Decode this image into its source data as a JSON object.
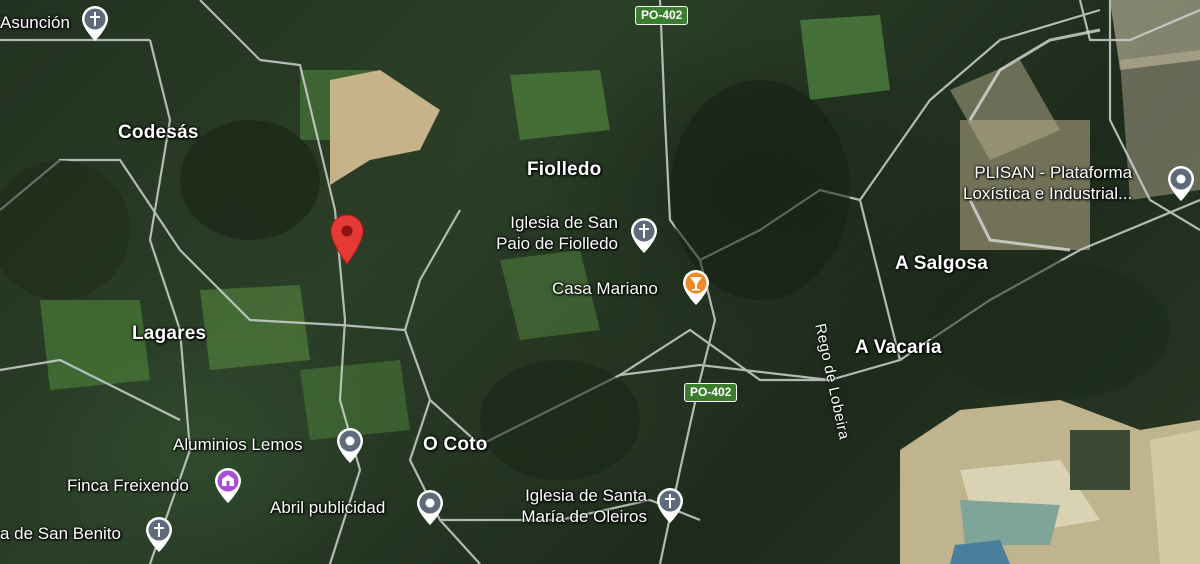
{
  "places": {
    "codesas": "Codesás",
    "fiolledo": "Fiolledo",
    "lagares": "Lagares",
    "a_salgosa": "A Salgosa",
    "a_vacaria": "A Vacaría",
    "o_coto": "O Coto"
  },
  "pois": {
    "asuncion": {
      "label": "Asunción",
      "icon": "church-icon"
    },
    "iglesia_san_paio": {
      "label_line1": "Iglesia de San",
      "label_line2": "Paio de Fiolledo",
      "icon": "church-icon"
    },
    "casa_mariano": {
      "label": "Casa Mariano",
      "icon": "bar-icon"
    },
    "plisan": {
      "label_line1": "PLISAN - Plataforma",
      "label_line2": "Loxística e Industrial...",
      "icon": "place-icon"
    },
    "aluminios_lemos": {
      "label": "Aluminios Lemos",
      "icon": "place-icon"
    },
    "finca_freixendo": {
      "label": "Finca Freixendo",
      "icon": "event-venue-icon"
    },
    "abril_publicidad": {
      "label": "Abril publicidad",
      "icon": "place-icon"
    },
    "san_benito": {
      "label": "a de San Benito",
      "icon": "church-icon"
    },
    "iglesia_santa_maria": {
      "label_line1": "Iglesia de Santa",
      "label_line2": "María de Oleiros",
      "icon": "church-icon"
    }
  },
  "roads": {
    "po402_top": "PO-402",
    "po402_mid": "PO-402",
    "rego_lobeira": "Rego de Lobeira"
  },
  "marker": {
    "icon": "location-pin-icon",
    "color": "#e53935"
  },
  "colors": {
    "poi_gray": "#5f6b7a",
    "bar_orange": "#f08a24",
    "venue_purple": "#a64fd6",
    "shield_green": "#3a7d2c"
  }
}
